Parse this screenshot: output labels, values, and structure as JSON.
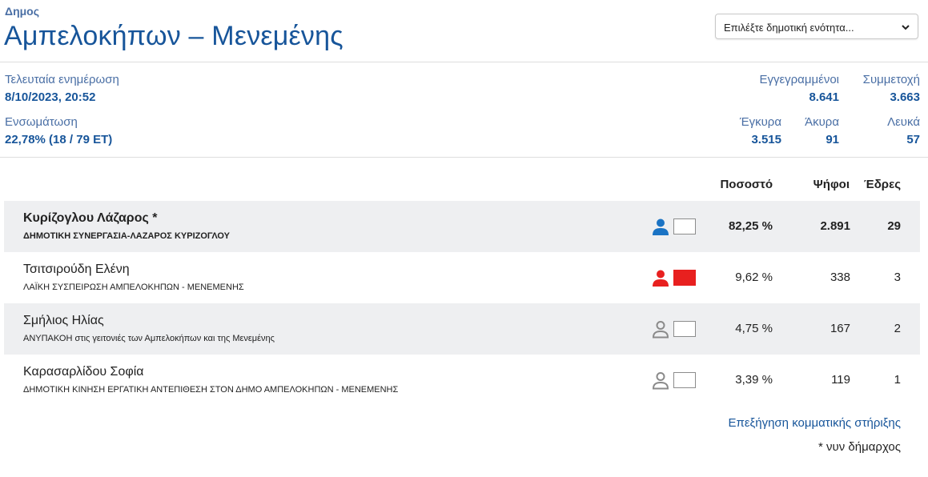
{
  "header": {
    "type_label": "Δημος",
    "name": "Αμπελοκήπων – Μενεμένης",
    "select": {
      "value": "Επιλέξτε δημοτική ενότητα..."
    }
  },
  "stats": {
    "last_update_label": "Τελευταία ενημέρωση",
    "last_update_value": "8/10/2023, 20:52",
    "progress_label": "Ενσωμάτωση",
    "progress_value": "22,78% (18 / 79 ΕΤ)",
    "registered_label": "Εγγεγραμμένοι",
    "registered_value": "8.641",
    "turnout_label": "Συμμετοχή",
    "turnout_value": "3.663",
    "valid_label": "Έγκυρα",
    "valid_value": "3.515",
    "invalid_label": "Άκυρα",
    "invalid_value": "91",
    "blank_label": "Λευκά",
    "blank_value": "57"
  },
  "table": {
    "headers": {
      "percent": "Ποσοστό",
      "votes": "Ψήφοι",
      "seats": "Έδρες"
    },
    "rows": [
      {
        "name": "Κυρίζογλου Λάζαρος *",
        "party": "ΔΗΜΟΤΙΚΗ ΣΥΝΕΡΓΑΣΙΑ-ΛΑΖΑΡΟΣ ΚΥΡΙΖΟΓΛΟΥ",
        "percent": "82,25 %",
        "votes": "2.891",
        "seats": "29",
        "icon": "person-filled-icon",
        "icon_color": "#1a73c4",
        "flag_color": "#ffffff"
      },
      {
        "name": "Τσιτσιρούδη Ελένη",
        "party": "ΛΑΪΚΗ ΣΥΣΠΕΙΡΩΣΗ ΑΜΠΕΛΟΚΗΠΩΝ - ΜΕΝΕΜΕΝΗΣ",
        "percent": "9,62 %",
        "votes": "338",
        "seats": "3",
        "icon": "person-filled-icon",
        "icon_color": "#e8201f",
        "flag_color": "#e8201f"
      },
      {
        "name": "Σμήλιος Ηλίας",
        "party": "ΑΝΥΠΑΚΟΗ στις γειτονιές των Αμπελοκήπων και της Μενεμένης",
        "percent": "4,75 %",
        "votes": "167",
        "seats": "2",
        "icon": "person-outline-icon",
        "icon_color": "#8a8a8a",
        "flag_color": "#ffffff"
      },
      {
        "name": "Καρασαρλίδου Σοφία",
        "party": "ΔΗΜΟΤΙΚΗ ΚΙΝΗΣΗ ΕΡΓΑΤΙΚΗ ΑΝΤΕΠΙΘΕΣΗ ΣΤΟΝ ΔΗΜΟ ΑΜΠΕΛΟΚΗΠΩΝ - ΜΕΝΕΜΕΝΗΣ",
        "percent": "3,39 %",
        "votes": "119",
        "seats": "1",
        "icon": "person-outline-icon",
        "icon_color": "#8a8a8a",
        "flag_color": "#ffffff"
      }
    ]
  },
  "footer": {
    "support_link": "Επεξήγηση κομματικής στήριξης",
    "note": "* νυν δήμαρχος"
  }
}
